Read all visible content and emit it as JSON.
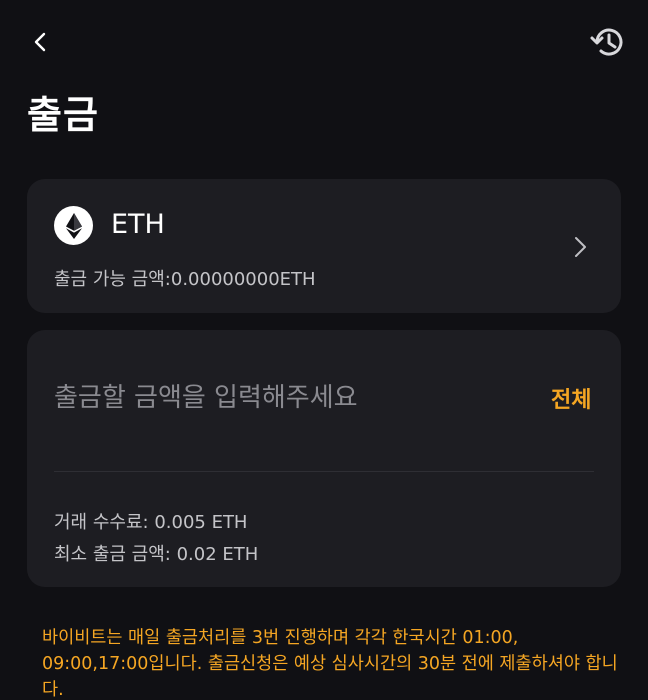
{
  "header": {
    "title": "출금",
    "back_icon": "chevron-left-icon",
    "history_icon": "history-icon"
  },
  "coin": {
    "symbol": "ETH",
    "icon": "ethereum-icon",
    "available_label": "출금 가능 금액:",
    "available_value": "0.00000000ETH"
  },
  "amount": {
    "placeholder": "출금할 금액을 입력해주세요",
    "value": "",
    "max_label": "전체"
  },
  "fees": {
    "fee_label": "거래 수수료: ",
    "fee_value": "0.005 ETH",
    "min_label": "최소 출금 금액: ",
    "min_value": "0.02 ETH"
  },
  "notice": {
    "text": "바이비트는 매일 출금처리를 3번 진행하며 각각 한국시간 01:00, 09:00,17:00입니다. 출금신청은 예상 심사시간의 30분 전에 제출하셔야 합니다."
  },
  "colors": {
    "background": "#101014",
    "card": "#1d1d22",
    "accent": "#f5a623",
    "text_secondary": "#c4c4c8",
    "placeholder": "#8a8a90"
  }
}
